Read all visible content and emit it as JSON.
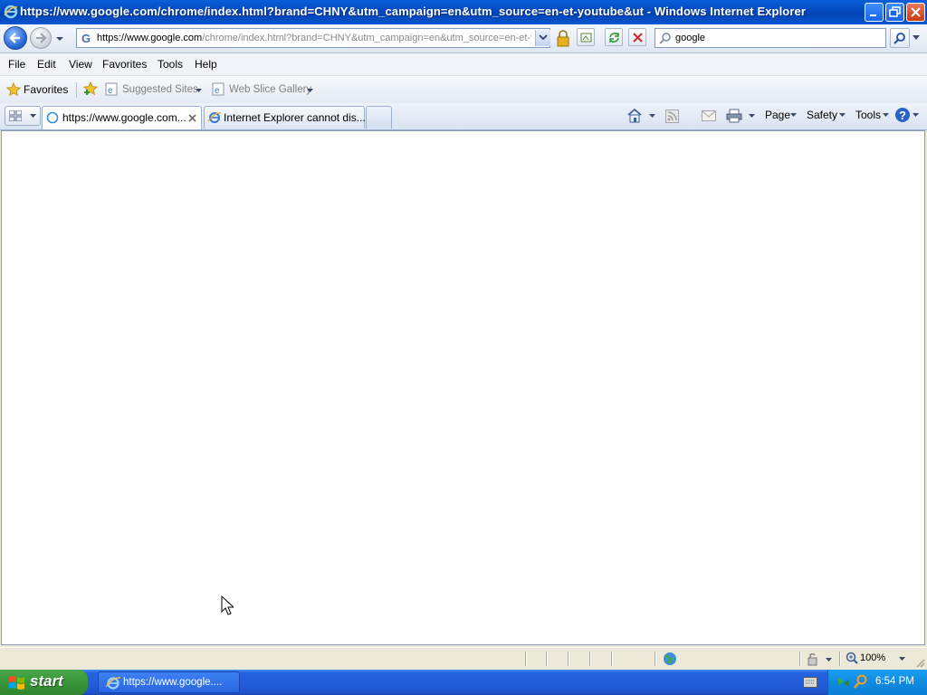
{
  "window": {
    "title": "https://www.google.com/chrome/index.html?brand=CHNY&utm_campaign=en&utm_source=en-et-youtube&ut - Windows Internet Explorer"
  },
  "address": {
    "scheme": "https://",
    "host": "www.google.com",
    "rest": "/chrome/index.html?brand=CHNY&utm_campaign=en&utm_source=en-et-youtube"
  },
  "search": {
    "value": "google"
  },
  "menu": [
    "File",
    "Edit",
    "View",
    "Favorites",
    "Tools",
    "Help"
  ],
  "favorites_bar": {
    "favorites_label": "Favorites",
    "links": [
      "Suggested Sites",
      "Web Slice Gallery"
    ]
  },
  "tabs": [
    {
      "label": "https://www.google.com...",
      "active": true
    },
    {
      "label": "Internet Explorer cannot dis...",
      "active": false
    }
  ],
  "command_bar": {
    "page": "Page",
    "safety": "Safety",
    "tools": "Tools"
  },
  "status_bar": {
    "zoom": "100%"
  },
  "taskbar": {
    "start_label": "start",
    "window_item": "https://www.google....",
    "clock": "6:54 PM"
  },
  "colors": {
    "titlebar": "#0348bf",
    "taskbar": "#245edc",
    "start": "#3c9a3c"
  }
}
